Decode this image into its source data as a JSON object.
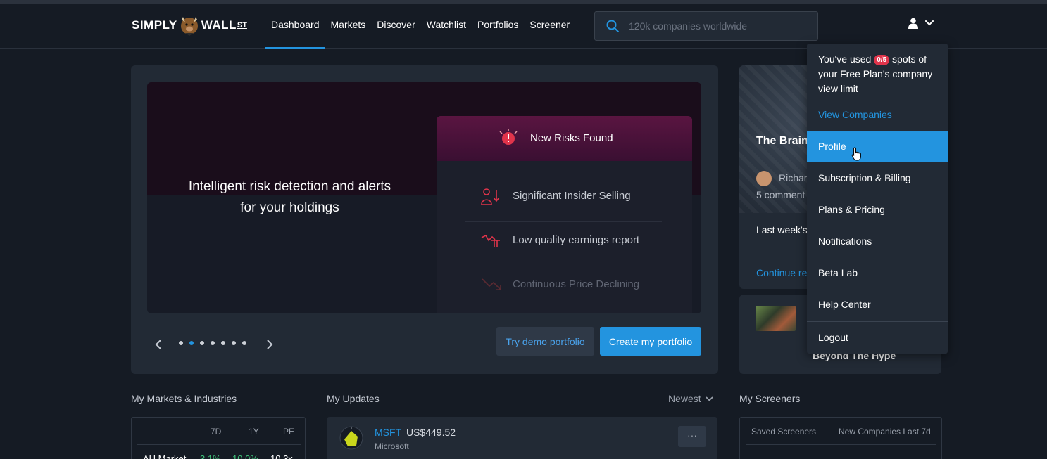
{
  "brand": {
    "word1": "SIMPLY",
    "word2": "WALL",
    "word3": "ST"
  },
  "nav": {
    "links": [
      {
        "label": "Dashboard",
        "active": true
      },
      {
        "label": "Markets"
      },
      {
        "label": "Discover"
      },
      {
        "label": "Watchlist"
      },
      {
        "label": "Portfolios"
      },
      {
        "label": "Screener"
      }
    ],
    "search_placeholder": "120k companies worldwide"
  },
  "hero": {
    "slide_text": "Intelligent risk detection and alerts for your holdings",
    "risk_card_title": "New Risks Found",
    "risks": [
      "Significant Insider Selling",
      "Low quality earnings report",
      "Continuous Price Declining"
    ],
    "try_demo_label": "Try demo portfolio",
    "create_label": "Create my portfolio",
    "dots_total": 7,
    "dot_active_index": 1
  },
  "article1": {
    "title": "The Brains Logic And",
    "author": "Richar",
    "comments": "5 comment",
    "body": "Last week's brief overvie industry and",
    "link": "Continue re"
  },
  "article2": {
    "title": "Beyond The Hype"
  },
  "sections": {
    "markets_title": "My Markets & Industries",
    "updates_title": "My Updates",
    "sort_label": "Newest",
    "screeners_title": "My Screeners"
  },
  "markets_table": {
    "headers": [
      "7D",
      "1Y",
      "PE"
    ],
    "row": {
      "name": "AU Market",
      "d7": "3.1%",
      "y1": "10.0%",
      "pe": "10.3x"
    }
  },
  "update": {
    "ticker": "MSFT",
    "price": "US$449.52",
    "company": "Microsoft",
    "more": "···"
  },
  "screeners_table": {
    "headers": [
      "Saved Screeners",
      "New Companies Last 7d"
    ]
  },
  "dropdown": {
    "limit_pre": "You've used",
    "limit_badge": "0/5",
    "limit_post": "spots of your Free Plan's company view limit",
    "view_companies": "View Companies",
    "items": [
      "Profile",
      "Subscription & Billing",
      "Plans & Pricing",
      "Notifications",
      "Beta Lab",
      "Help Center"
    ],
    "logout": "Logout"
  },
  "colors": {
    "accent": "#2394df",
    "background": "#151b24",
    "card": "#222a35",
    "positive": "#3fc47a",
    "badge": "#e0344b"
  }
}
